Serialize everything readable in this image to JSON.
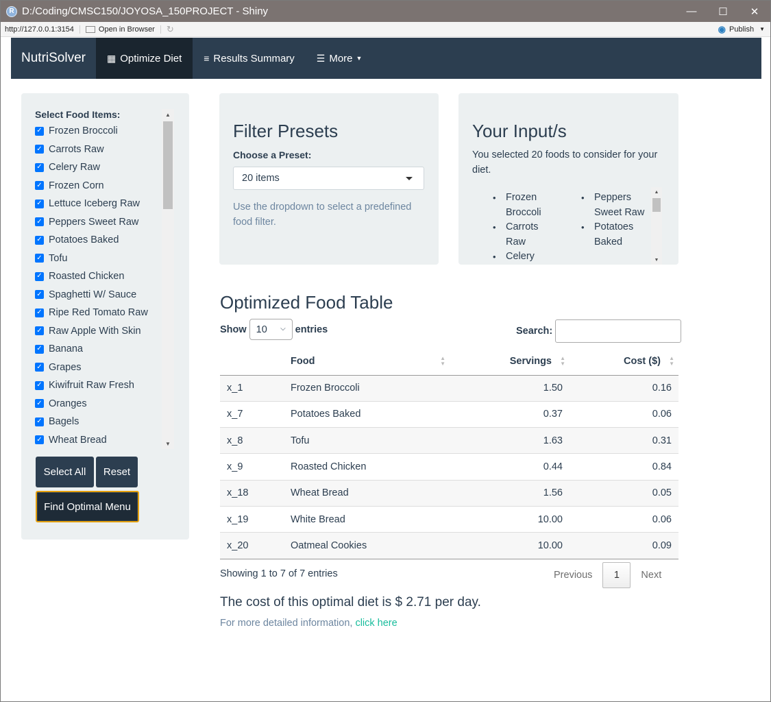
{
  "window": {
    "title": "D:/Coding/CMSC150/JOYOSA_150PROJECT - Shiny",
    "app_icon": "R",
    "minimize": "—",
    "maximize": "☐",
    "close": "✕"
  },
  "addressbar": {
    "url": "http://127.0.0.1:3154",
    "open_in_browser": "Open in Browser",
    "publish": "Publish"
  },
  "navbar": {
    "brand": "NutriSolver",
    "items": [
      {
        "label": "Optimize Diet",
        "icon": "calculator-icon",
        "active": true
      },
      {
        "label": "Results Summary",
        "icon": "bar-chart-icon",
        "active": false
      },
      {
        "label": "More",
        "icon": "hamburger-icon",
        "active": false
      }
    ]
  },
  "sidebar": {
    "title": "Select Food Items:",
    "foods": [
      "Frozen Broccoli",
      "Carrots Raw",
      "Celery Raw",
      "Frozen Corn",
      "Lettuce Iceberg Raw",
      "Peppers Sweet Raw",
      "Potatoes Baked",
      "Tofu",
      "Roasted Chicken",
      "Spaghetti W/ Sauce",
      "Ripe Red Tomato Raw",
      "Raw Apple With Skin",
      "Banana",
      "Grapes",
      "Kiwifruit Raw Fresh",
      "Oranges",
      "Bagels",
      "Wheat Bread"
    ],
    "select_all": "Select All",
    "reset": "Reset",
    "find_optimal": "Find Optimal Menu"
  },
  "filter_presets": {
    "title": "Filter Presets",
    "label": "Choose a Preset:",
    "selected": "20 items",
    "help": "Use the dropdown to select a predefined food filter."
  },
  "your_input": {
    "title": "Your Input/s",
    "description": "You selected 20 foods to consider for your diet.",
    "col1": [
      "Frozen Broccoli",
      "Carrots Raw",
      "Celery"
    ],
    "col2": [
      "Peppers Sweet Raw",
      "Potatoes Baked"
    ]
  },
  "table": {
    "title": "Optimized Food Table",
    "show": "Show",
    "entries_value": "10",
    "entries": "entries",
    "search_label": "Search:",
    "headers": [
      "",
      "Food",
      "Servings",
      "Cost ($)"
    ],
    "rows": [
      [
        "x_1",
        "Frozen Broccoli",
        "1.50",
        "0.16"
      ],
      [
        "x_7",
        "Potatoes Baked",
        "0.37",
        "0.06"
      ],
      [
        "x_8",
        "Tofu",
        "1.63",
        "0.31"
      ],
      [
        "x_9",
        "Roasted Chicken",
        "0.44",
        "0.84"
      ],
      [
        "x_18",
        "Wheat Bread",
        "1.56",
        "0.05"
      ],
      [
        "x_19",
        "White Bread",
        "10.00",
        "0.06"
      ],
      [
        "x_20",
        "Oatmeal Cookies",
        "10.00",
        "0.09"
      ]
    ],
    "showing": "Showing 1 to 7 of 7 entries",
    "previous": "Previous",
    "page": "1",
    "next": "Next"
  },
  "summary": {
    "cost_line": "The cost of this optimal diet is $ 2.71 per day.",
    "more_prefix": "For more detailed information, ",
    "more_link": "click here"
  },
  "colors": {
    "navbar": "#2c3e50",
    "nav_active": "#1a252f",
    "panel": "#ecf0f1",
    "link": "#18bc9c",
    "checkbox": "#0075ff",
    "focus_ring": "#e5a00d"
  }
}
